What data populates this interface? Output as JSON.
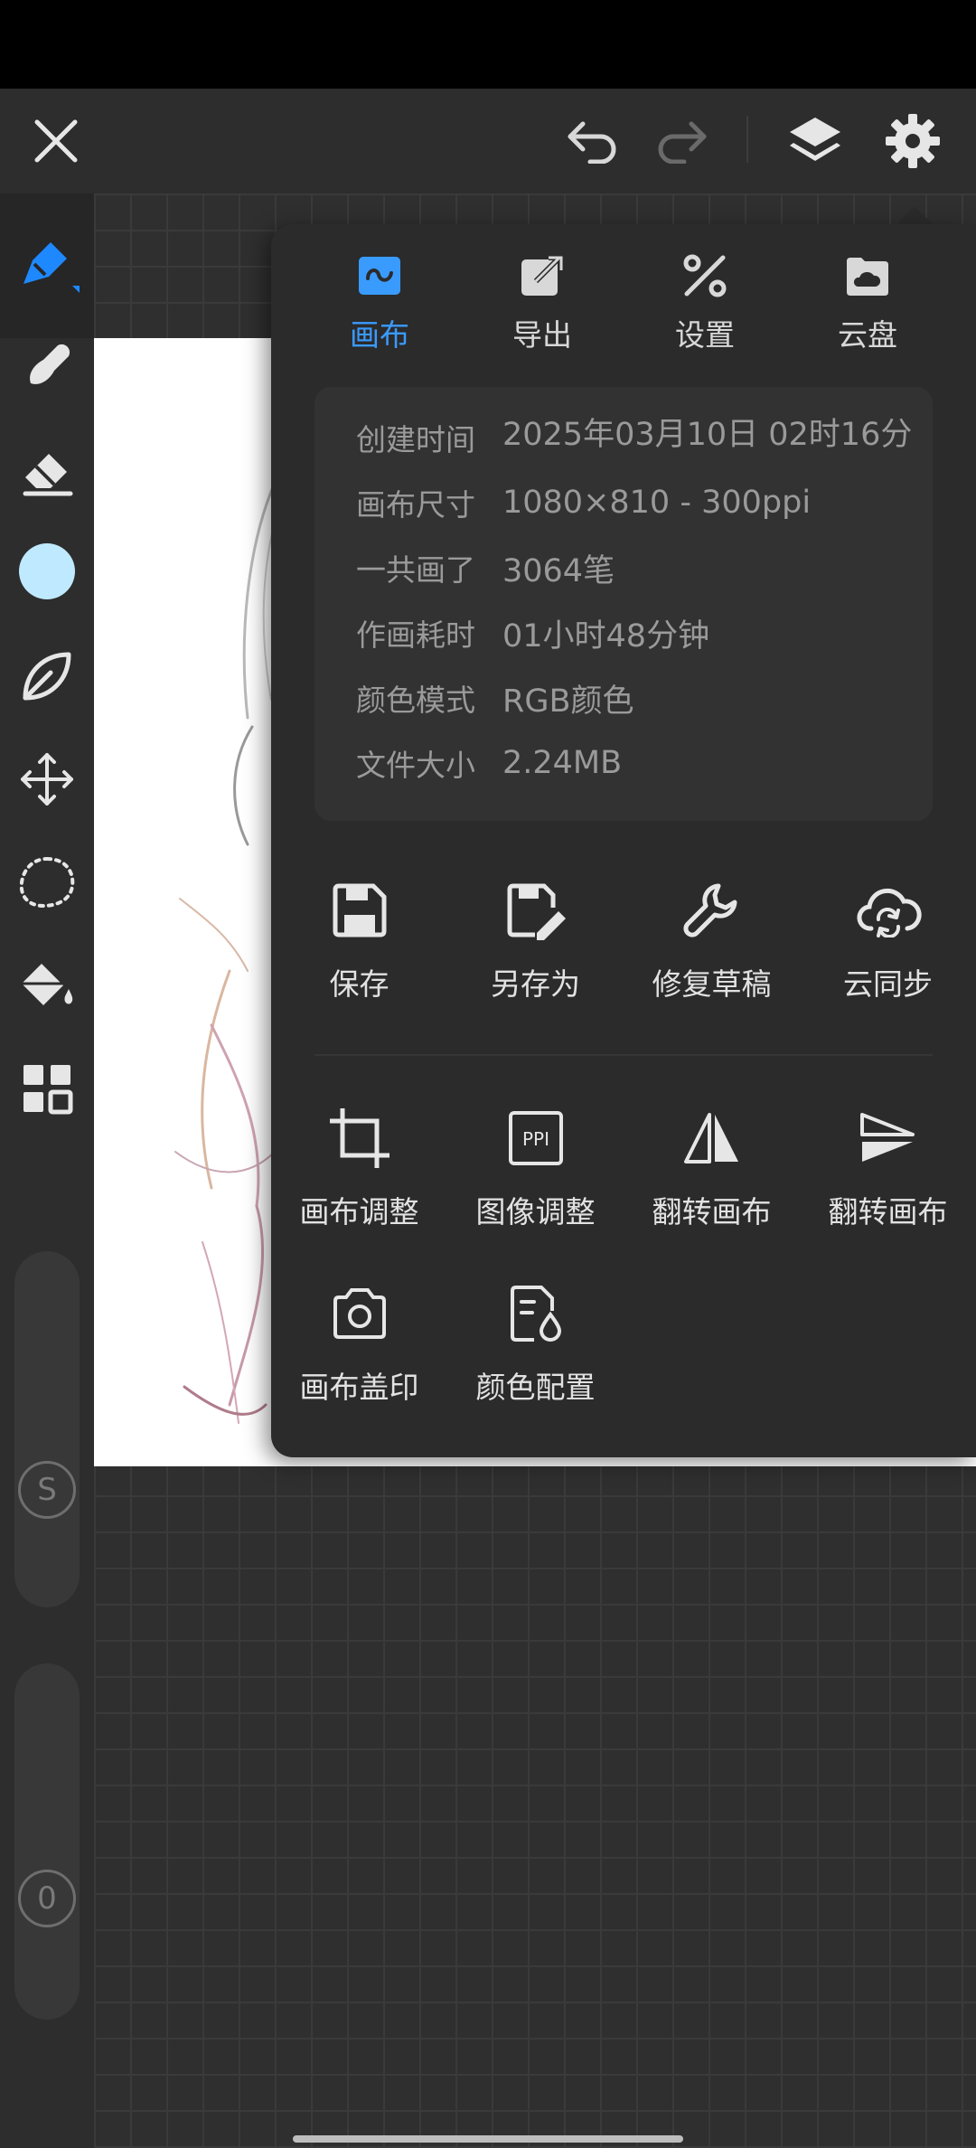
{
  "topbar": {
    "close_icon": "close-icon",
    "undo_icon": "undo-icon",
    "redo_icon": "redo-icon",
    "layers_icon": "layers-icon",
    "settings_icon": "gear-icon"
  },
  "left_tools": [
    {
      "name": "brush-tool",
      "icon": "pen-icon",
      "active": true
    },
    {
      "name": "smudge-tool",
      "icon": "smudge-icon"
    },
    {
      "name": "eraser-tool",
      "icon": "eraser-icon"
    },
    {
      "name": "color-tool",
      "icon": "color-swatch",
      "color": "#bfe9ff"
    },
    {
      "name": "leaf-tool",
      "icon": "leaf-icon"
    },
    {
      "name": "move-tool",
      "icon": "move-icon"
    },
    {
      "name": "lasso-tool",
      "icon": "lasso-icon"
    },
    {
      "name": "fill-tool",
      "icon": "paint-bucket-icon"
    },
    {
      "name": "more-tools",
      "icon": "grid-icon"
    }
  ],
  "sliders": {
    "size_label": "S",
    "opacity_label": "0"
  },
  "panel": {
    "tabs": [
      {
        "label": "画布",
        "active": true
      },
      {
        "label": "导出"
      },
      {
        "label": "设置"
      },
      {
        "label": "云盘"
      }
    ],
    "info": [
      {
        "key": "创建时间",
        "value": "2025年03月10日 02时16分"
      },
      {
        "key": "画布尺寸",
        "value": "1080×810 - 300ppi"
      },
      {
        "key": "一共画了",
        "value": "3064笔"
      },
      {
        "key": "作画耗时",
        "value": "01小时48分钟"
      },
      {
        "key": "颜色模式",
        "value": "RGB颜色"
      },
      {
        "key": "文件大小",
        "value": "2.24MB"
      }
    ],
    "actions_row1": [
      {
        "label": "保存",
        "icon": "save-icon"
      },
      {
        "label": "另存为",
        "icon": "save-as-icon"
      },
      {
        "label": "修复草稿",
        "icon": "wrench-icon"
      },
      {
        "label": "云同步",
        "icon": "cloud-sync-icon"
      }
    ],
    "actions_row2": [
      {
        "label": "画布调整",
        "icon": "crop-icon"
      },
      {
        "label": "图像调整",
        "icon": "ppi-icon",
        "badge": "PPI"
      },
      {
        "label": "翻转画布",
        "icon": "flip-horizontal-icon"
      },
      {
        "label": "翻转画布",
        "icon": "flip-vertical-icon"
      }
    ],
    "actions_row3": [
      {
        "label": "画布盖印",
        "icon": "camera-icon"
      },
      {
        "label": "颜色配置",
        "icon": "color-profile-icon"
      }
    ]
  },
  "colors": {
    "accent": "#3a9bff",
    "panel_bg": "#2b2b2b",
    "info_bg": "#323232"
  }
}
